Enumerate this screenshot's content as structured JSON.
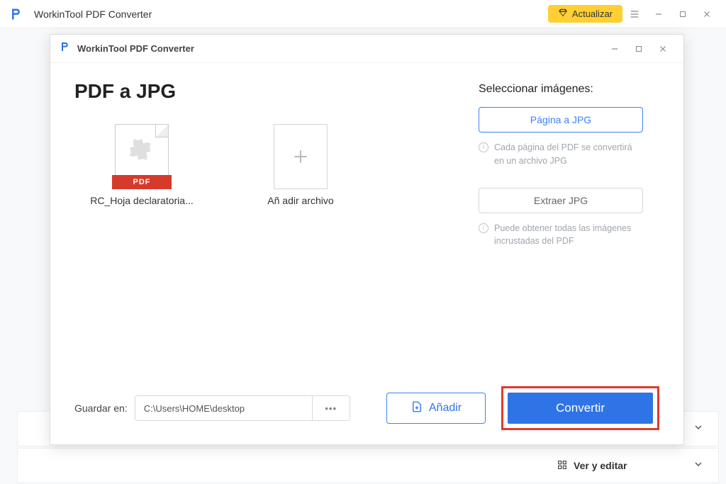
{
  "main": {
    "title": "WorkinTool PDF Converter",
    "upgrade": "Actualizar"
  },
  "bgRows": {
    "viewEdit": "Ver y editar"
  },
  "dialog": {
    "title": "WorkinTool PDF Converter",
    "heading": "PDF a JPG",
    "file": {
      "name": "RC_Hoja declaratoria...",
      "badge": "PDF"
    },
    "addTile": "Añ adir archivo",
    "right": {
      "heading": "Seleccionar imágenes:",
      "pageBtn": "Página a JPG",
      "pageHint": "Cada página del PDF se convertirá en un archivo JPG",
      "extractBtn": "Extraer JPG",
      "extractHint": "Puede obtener todas las imágenes incrustadas del PDF"
    },
    "footer": {
      "saveLabel": "Guardar en:",
      "path": "C:\\Users\\HOME\\desktop",
      "more": "•••",
      "add": "Añadir",
      "convert": "Convertir"
    }
  }
}
